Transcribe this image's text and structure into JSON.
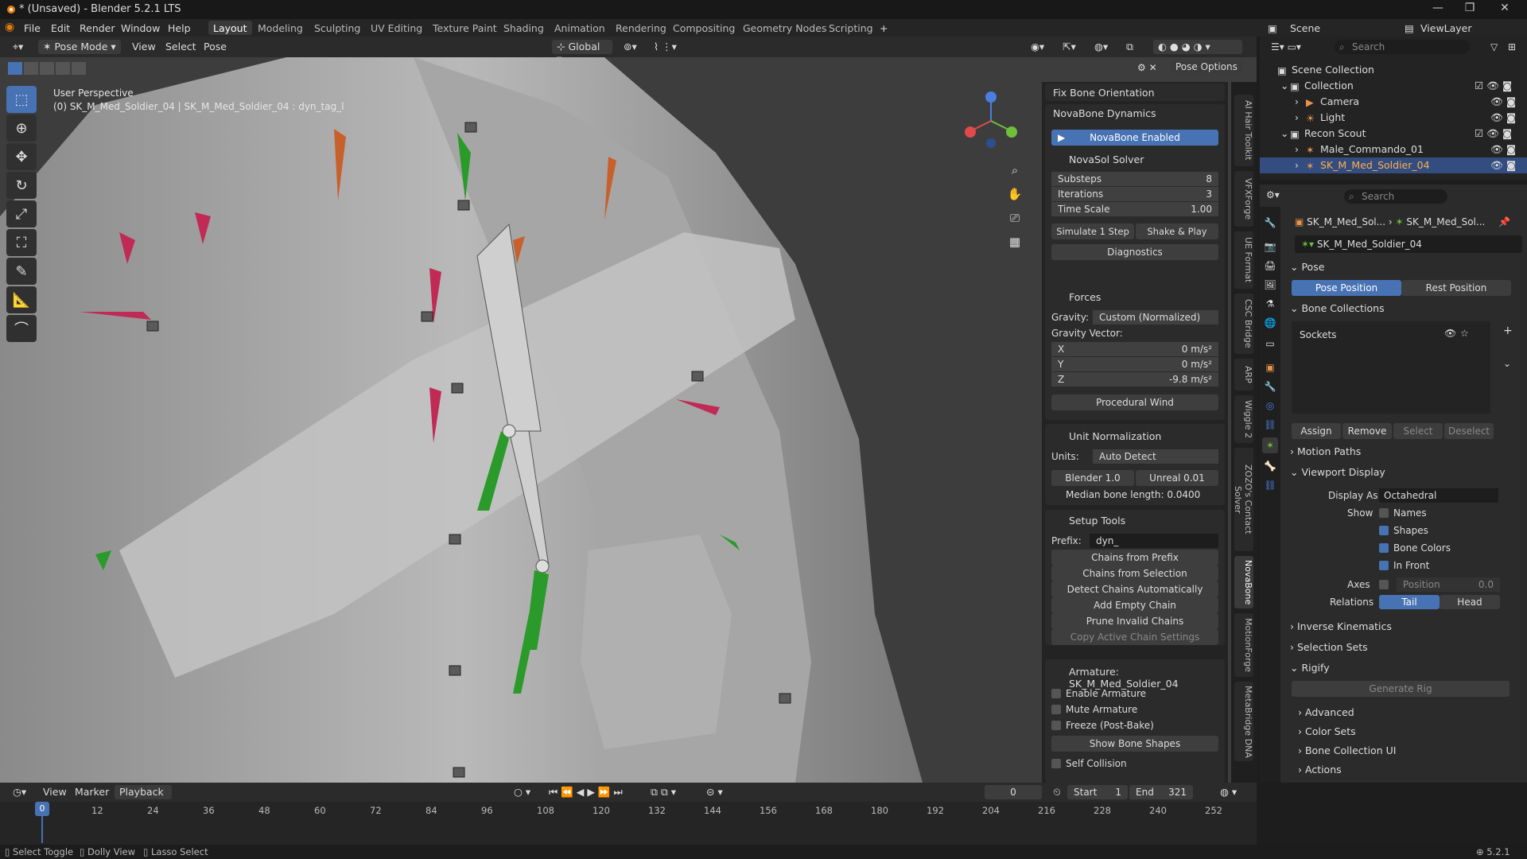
{
  "window": {
    "title": "* (Unsaved) - Blender 5.2.1 LTS",
    "minimize": "—",
    "maximize": "❐",
    "close": "✕"
  },
  "menu": [
    "File",
    "Edit",
    "Render",
    "Window",
    "Help"
  ],
  "workspaces": [
    "Layout",
    "Modeling",
    "Sculpting",
    "UV Editing",
    "Texture Paint",
    "Shading",
    "Animation",
    "Rendering",
    "Compositing",
    "Geometry Nodes",
    "Scripting"
  ],
  "active_workspace": "Layout",
  "scene": {
    "label": "Scene",
    "viewlayer": "ViewLayer"
  },
  "viewport_header": {
    "mode": "Pose Mode",
    "view": "View",
    "select": "Select",
    "pose": "Pose",
    "orientation": "Global",
    "pose_options": "Pose Options"
  },
  "viewport": {
    "perspective": "User Perspective",
    "object_info": "(0) SK_M_Med_Soldier_04 | SK_M_Med_Soldier_04 : dyn_tag_l"
  },
  "npanel": {
    "fix_bone_orientation": "Fix Bone Orientation",
    "novabone_dynamics": "NovaBone Dynamics",
    "novabone_enabled": "NovaBone Enabled",
    "novasol_solver": "NovaSol Solver",
    "substeps_label": "Substeps",
    "substeps_value": "8",
    "iterations_label": "Iterations",
    "iterations_value": "3",
    "timescale_label": "Time Scale",
    "timescale_value": "1.00",
    "simulate_step": "Simulate 1 Step",
    "shake_play": "Shake & Play",
    "diagnostics": "Diagnostics",
    "forces": "Forces",
    "gravity_label": "Gravity:",
    "gravity_value": "Custom (Normalized)",
    "gravity_vector": "Gravity Vector:",
    "gx_label": "X",
    "gx_value": "0 m/s²",
    "gy_label": "Y",
    "gy_value": "0 m/s²",
    "gz_label": "Z",
    "gz_value": "-9.8 m/s²",
    "procedural_wind": "Procedural Wind",
    "unit_normalization": "Unit Normalization",
    "units_label": "Units:",
    "units_value": "Auto Detect",
    "blender_unit": "Blender 1.0",
    "unreal_unit": "Unreal 0.01",
    "median_bone": "Median bone length: 0.0400",
    "setup_tools": "Setup Tools",
    "prefix_label": "Prefix:",
    "prefix_value": "dyn_",
    "chains_prefix": "Chains from Prefix",
    "chains_selection": "Chains from Selection",
    "detect_chains": "Detect Chains Automatically",
    "add_empty_chain": "Add Empty Chain",
    "prune_chains": "Prune Invalid Chains",
    "copy_chain": "Copy Active Chain Settings",
    "armature_header": "Armature: SK_M_Med_Soldier_04",
    "enable_armature": "Enable Armature",
    "mute_armature": "Mute Armature",
    "freeze": "Freeze (Post-Bake)",
    "show_bone_shapes": "Show Bone Shapes",
    "self_collision": "Self Collision"
  },
  "vtabs": [
    "AI Hair Toolkit",
    "VFXForge",
    "UE Format",
    "CSC Bridge",
    "ARP",
    "Wiggle 2",
    "ZOZO's Contact Solver",
    "NovaBone",
    "MotionForge",
    "MetaBridge DNA"
  ],
  "vtab_active": "NovaBone",
  "outliner": {
    "search_placeholder": "Search",
    "rows": [
      "Scene Collection",
      "Collection",
      "Camera",
      "Light",
      "Recon Scout",
      "Male_Commando_01",
      "SK_M_Med_Soldier_04"
    ]
  },
  "properties": {
    "search_placeholder": "Search",
    "crumb1": "SK_M_Med_Sol...",
    "crumb2": "SK_M_Med_Sol...",
    "datablock": "SK_M_Med_Soldier_04",
    "pose": "Pose",
    "pose_position": "Pose Position",
    "rest_position": "Rest Position",
    "bone_collections": "Bone Collections",
    "sockets": "Sockets",
    "assign": "Assign",
    "remove": "Remove",
    "select": "Select",
    "deselect": "Deselect",
    "motion_paths": "Motion Paths",
    "viewport_display": "Viewport Display",
    "display_as_label": "Display As",
    "display_as_value": "Octahedral",
    "show_label": "Show",
    "names": "Names",
    "shapes": "Shapes",
    "bone_colors": "Bone Colors",
    "in_front": "In Front",
    "axes_label": "Axes",
    "position_label": "Position",
    "position_value": "0.0",
    "relations_label": "Relations",
    "tail": "Tail",
    "head": "Head",
    "inverse_kinematics": "Inverse Kinematics",
    "selection_sets": "Selection Sets",
    "rigify": "Rigify",
    "generate_rig": "Generate Rig",
    "advanced": "Advanced",
    "color_sets": "Color Sets",
    "bone_collection_ui": "Bone Collection UI",
    "actions": "Actions"
  },
  "timeline": {
    "view": "View",
    "marker": "Marker",
    "playback": "Playback",
    "current": "0",
    "start_label": "Start",
    "start_value": "1",
    "end_label": "End",
    "end_value": "321",
    "ticks": [
      "0",
      "12",
      "24",
      "36",
      "48",
      "60",
      "72",
      "84",
      "96",
      "108",
      "120",
      "132",
      "144",
      "156",
      "168",
      "180",
      "192",
      "204",
      "216",
      "228",
      "240",
      "252"
    ]
  },
  "statusbar": {
    "select_toggle": "Select Toggle",
    "dolly_view": "Dolly View",
    "lasso_select": "Lasso Select",
    "version": "5.2.1"
  }
}
